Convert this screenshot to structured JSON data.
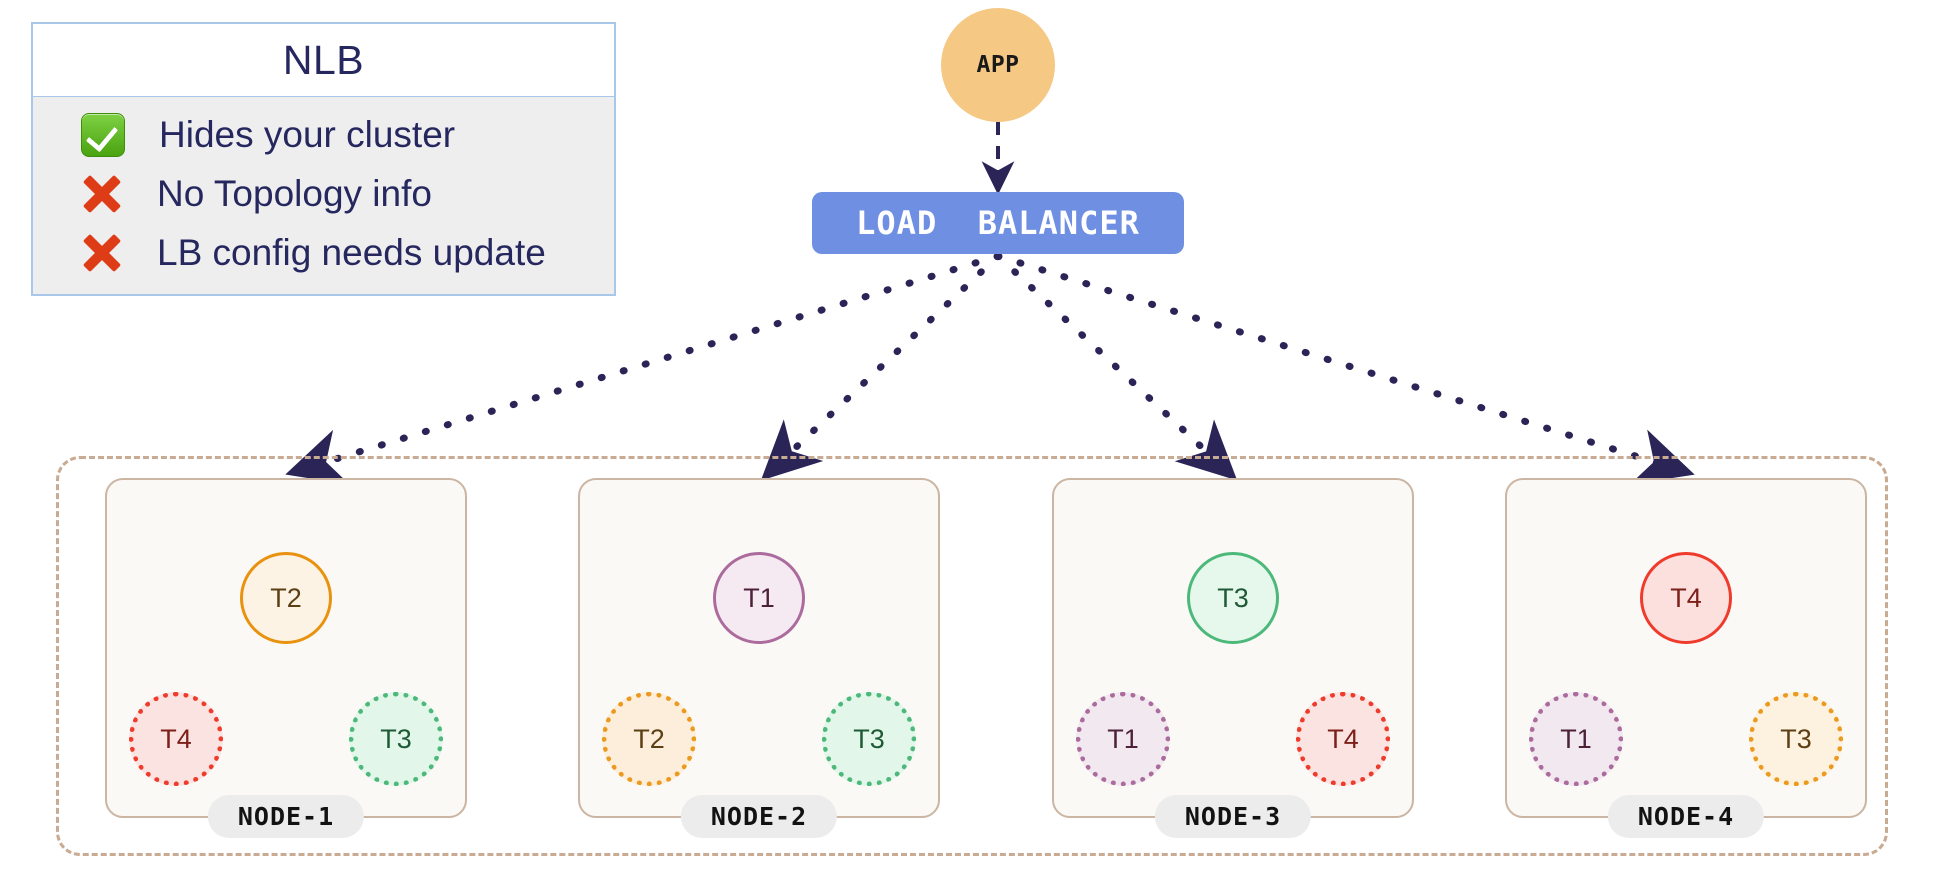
{
  "legend": {
    "title": "NLB",
    "rows": [
      {
        "mark": "check-icon",
        "type": "check",
        "text": "Hides your cluster"
      },
      {
        "mark": "cross-icon",
        "type": "cross",
        "text": "No Topology info"
      },
      {
        "mark": "cross-icon",
        "type": "cross",
        "text": "LB config needs update"
      }
    ]
  },
  "app": {
    "label": "APP"
  },
  "load_balancer": {
    "label": "LOAD  BALANCER"
  },
  "cluster": {
    "nodes": [
      {
        "label": "NODE-1",
        "pods": [
          {
            "id": "T2",
            "role": "primary",
            "position": "center-top",
            "style": "solid",
            "color": "#e8920f",
            "fill": "#fdf3e4",
            "text": "#5c3f14"
          },
          {
            "id": "T4",
            "role": "replica",
            "position": "bottom-left",
            "style": "dotted",
            "color": "#ef3b2c",
            "fill": "#fbe3e1",
            "text": "#7c2019"
          },
          {
            "id": "T3",
            "role": "replica",
            "position": "bottom-right",
            "style": "dotted",
            "color": "#4cb97a",
            "fill": "#e3f6ea",
            "text": "#1e5a36"
          }
        ]
      },
      {
        "label": "NODE-2",
        "pods": [
          {
            "id": "T1",
            "role": "primary",
            "position": "center-top",
            "style": "solid",
            "color": "#ab6b9c",
            "fill": "#f5eaf2",
            "text": "#4c2139"
          },
          {
            "id": "T2",
            "role": "replica",
            "position": "bottom-left",
            "style": "dotted",
            "color": "#eb9a1e",
            "fill": "#fdeedb",
            "text": "#5c3f14"
          },
          {
            "id": "T3",
            "role": "replica",
            "position": "bottom-right",
            "style": "dotted",
            "color": "#4cb97a",
            "fill": "#e3f6ea",
            "text": "#1e5a36"
          }
        ]
      },
      {
        "label": "NODE-3",
        "pods": [
          {
            "id": "T3",
            "role": "primary",
            "position": "center-top",
            "style": "solid",
            "color": "#4cb97a",
            "fill": "#e6f8ec",
            "text": "#1e5a36"
          },
          {
            "id": "T1",
            "role": "replica",
            "position": "bottom-left",
            "style": "dotted",
            "color": "#ab6b9c",
            "fill": "#f2e8f0",
            "text": "#4c2139"
          },
          {
            "id": "T4",
            "role": "replica",
            "position": "bottom-right",
            "style": "dotted",
            "color": "#ef3b2c",
            "fill": "#fbe3e1",
            "text": "#7c2019"
          }
        ]
      },
      {
        "label": "NODE-4",
        "pods": [
          {
            "id": "T4",
            "role": "primary",
            "position": "center-top",
            "style": "solid",
            "color": "#ef3b2c",
            "fill": "#fbe0de",
            "text": "#7c2019"
          },
          {
            "id": "T1",
            "role": "replica",
            "position": "bottom-left",
            "style": "dotted",
            "color": "#ab6b9c",
            "fill": "#f2e8f0",
            "text": "#4c2139"
          },
          {
            "id": "T3",
            "role": "replica",
            "position": "bottom-right",
            "style": "dotted",
            "color": "#eb9a1e",
            "fill": "#fdf1df",
            "text": "#5c3f14"
          }
        ]
      }
    ]
  },
  "edges": {
    "app_to_lb": {
      "style": "dashed",
      "color": "#2b2457"
    },
    "lb_to_nodes": {
      "style": "dotted",
      "color": "#2b2457",
      "count": 4
    }
  },
  "colors": {
    "app_fill": "#f5c884",
    "lb_fill": "#6f8fe3",
    "legend_border": "#a9c7e8",
    "legend_body": "#eeeeee",
    "legend_text": "#25275e",
    "cluster_border": "#c9ab93",
    "node_border": "#cbb5a3",
    "node_fill": "#fbf9f6",
    "node_pill": "#ececec",
    "edge": "#2b2457",
    "check": "#4aa310",
    "cross": "#dd3c17"
  }
}
